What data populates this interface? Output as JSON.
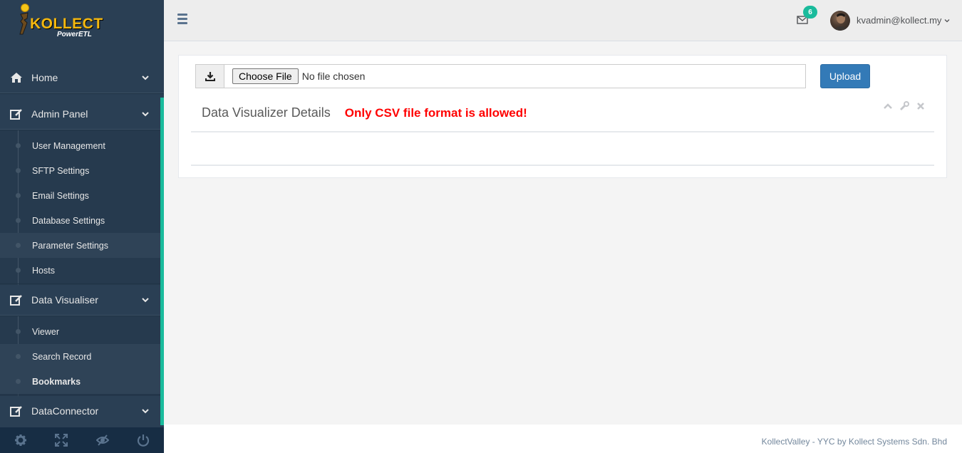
{
  "brand": {
    "name": "KOLLECT",
    "tagline": "PowerETL"
  },
  "sidebar": {
    "home": {
      "label": "Home"
    },
    "admin_panel": {
      "label": "Admin Panel",
      "items": [
        "User Management",
        "SFTP Settings",
        "Email Settings",
        "Database Settings",
        "Parameter Settings",
        "Hosts"
      ]
    },
    "data_visualiser": {
      "label": "Data Visualiser",
      "items": [
        "Viewer",
        "Search Record",
        "Bookmarks"
      ]
    },
    "data_connector": {
      "label": "DataConnector"
    }
  },
  "topnav": {
    "mail_count": "6",
    "user": "kvadmin@kollect.my"
  },
  "upload": {
    "choose_label": "Choose File",
    "file_status": "No file chosen",
    "button_label": "Upload"
  },
  "panel": {
    "title": "Data Visualizer Details",
    "warning": "Only CSV file format is allowed!"
  },
  "footer": {
    "text": "KollectValley - YYC by Kollect Systems Sdn. Bhd"
  },
  "colors": {
    "sidebar": "#2a3f54",
    "accent": "#1abb9c",
    "primary_button": "#337ab7",
    "warning": "#ff0000"
  }
}
